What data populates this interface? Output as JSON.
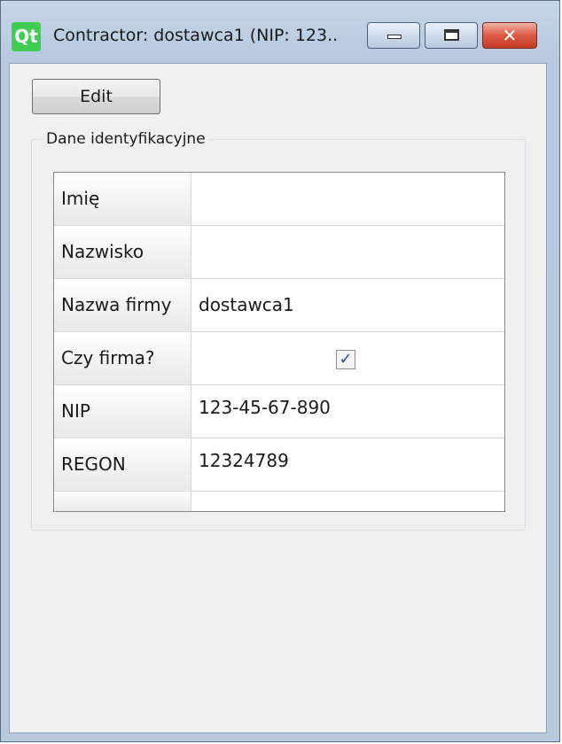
{
  "window": {
    "title": "Contractor: dostawca1 (NIP: 123..",
    "logo_text": "Qt",
    "minimize_icon": "minimize-icon",
    "maximize_icon": "maximize-icon",
    "close_icon": "close-icon",
    "close_glyph": "✕"
  },
  "toolbar": {
    "edit_label": "Edit"
  },
  "group": {
    "title": "Dane identyfikacyjne",
    "rows": [
      {
        "label": "Imię",
        "value": ""
      },
      {
        "label": "Nazwisko",
        "value": ""
      },
      {
        "label": "Nazwa firmy",
        "value": "dostawca1"
      },
      {
        "label": "Czy firma?",
        "checked": true,
        "check_glyph": "✓"
      },
      {
        "label": "NIP",
        "value": "123-45-67-890"
      },
      {
        "label": "REGON",
        "value": "12324789"
      }
    ]
  }
}
